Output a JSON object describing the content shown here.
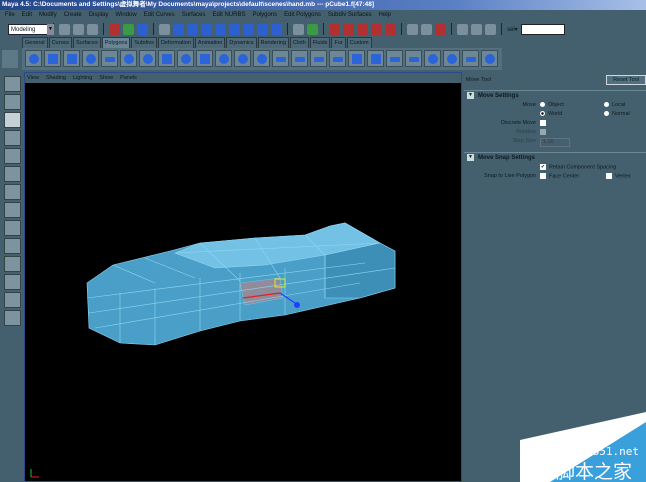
{
  "title": {
    "text": "Maya 4.5: C:\\Documents and Settings\\虚拟舞者\\My Documents\\maya\\projects\\default\\scenes\\hand.mb  ---  pCube1.f[47:48]"
  },
  "menu": [
    "File",
    "Edit",
    "Modify",
    "Create",
    "Display",
    "Window",
    "Edit Curves",
    "Surfaces",
    "Edit NURBS",
    "Polygons",
    "Edit Polygons",
    "Subdiv Surfaces",
    "Help"
  ],
  "toolbar": {
    "mode": "Modeling",
    "sel_label": "sel▾",
    "sel_value": ""
  },
  "shelf_tabs": [
    "General",
    "Curves",
    "Surfaces",
    "Polygons",
    "Subdivs",
    "Deformation",
    "Animation",
    "Dynamics",
    "Rendering",
    "Cloth",
    "Fluids",
    "Fur",
    "Custom"
  ],
  "active_shelf_tab": "Polygons",
  "viewport_menu": [
    "View",
    "Shading",
    "Lighting",
    "Show",
    "Panels"
  ],
  "panel": {
    "tool_name": "Move Tool",
    "reset_label": "Reset Tool",
    "move_settings": {
      "title": "Move Settings",
      "move_label": "Move",
      "options": [
        "Object",
        "Local",
        "World",
        "Normal"
      ],
      "selected": "World",
      "discrete_label": "Discrete Move",
      "discrete": false,
      "relative_label": "Relative",
      "step_label": "Step Size",
      "step_value": "1.00"
    },
    "snap_settings": {
      "title": "Move Snap Settings",
      "retain_label": "Retain Component Spacing",
      "retain": true,
      "snap_label": "Snap to Live Polygon",
      "face_center": "Face Center",
      "vertex": "Vertex"
    }
  },
  "colors": {
    "mesh": "#5fb8e0",
    "bg": "#44606e"
  },
  "watermark": {
    "site": "jb51.net",
    "name": "脚本之家"
  }
}
